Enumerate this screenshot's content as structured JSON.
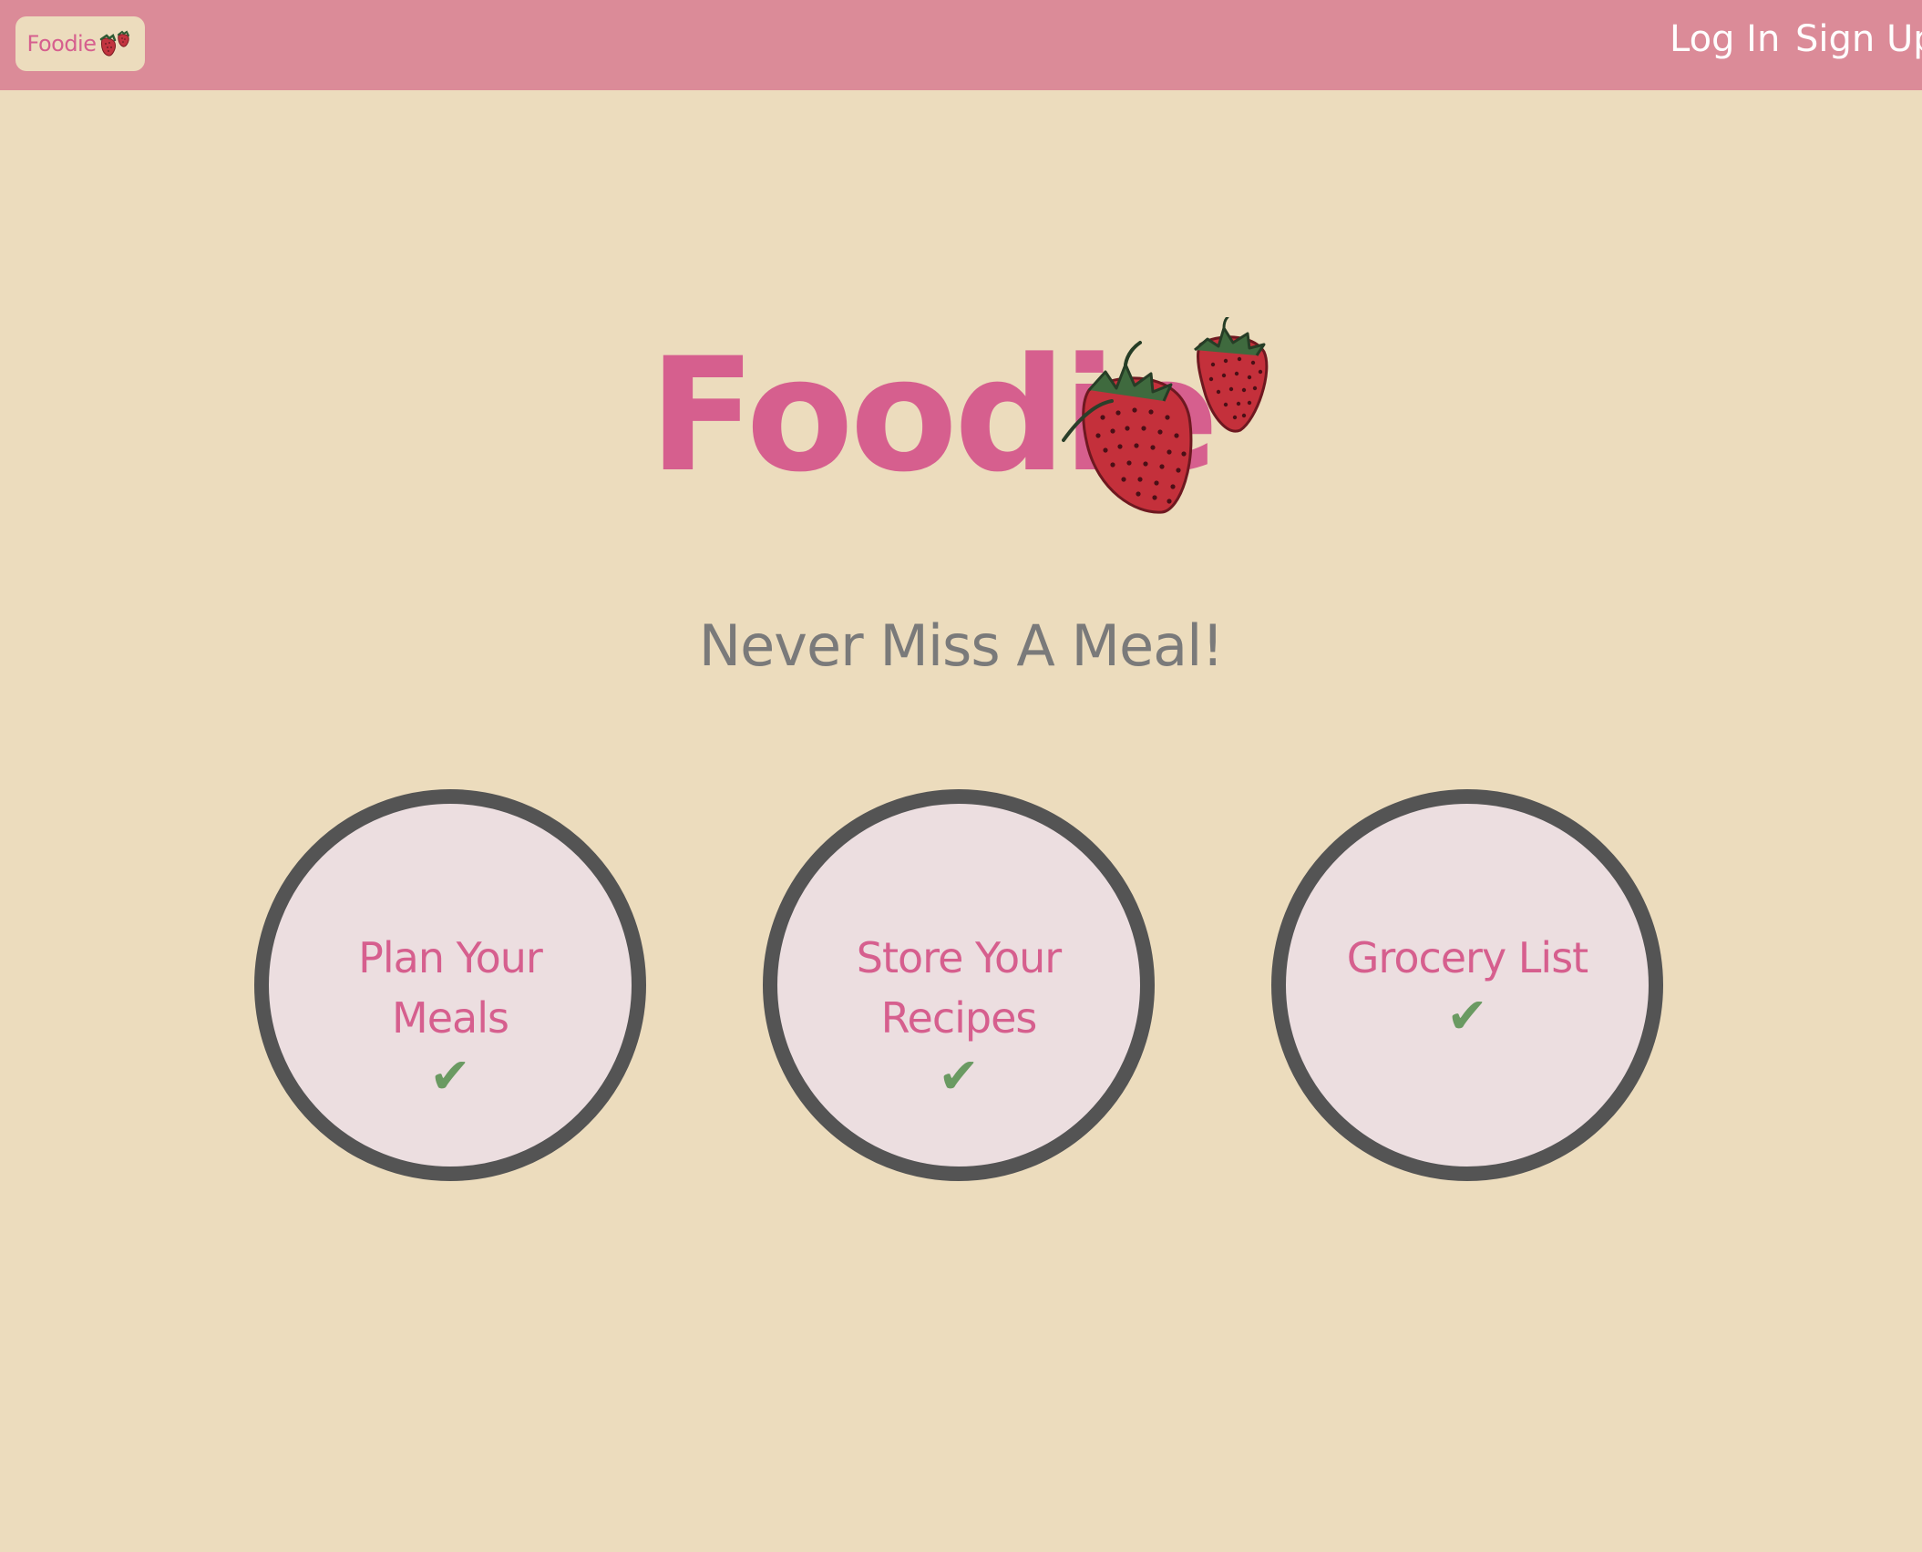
{
  "nav": {
    "brand": "Foodie",
    "login": "Log In",
    "signup": "Sign Up"
  },
  "hero": {
    "title": "Foodie",
    "tagline": "Never Miss A Meal!"
  },
  "features": [
    {
      "label": "Plan Your Meals",
      "check": "✔"
    },
    {
      "label": "Store Your Recipes",
      "check": "✔"
    },
    {
      "label": "Grocery List",
      "check": "✔"
    }
  ],
  "colors": {
    "background": "#ecdcbd",
    "navbar": "#db8b98",
    "accent_pink": "#d65f8e",
    "circle_fill": "#ecdee0",
    "circle_border": "#545454",
    "check_green": "#6a9a62",
    "tagline_gray": "#7a7a7a"
  },
  "icons": [
    "strawberry-icon",
    "check-icon"
  ]
}
